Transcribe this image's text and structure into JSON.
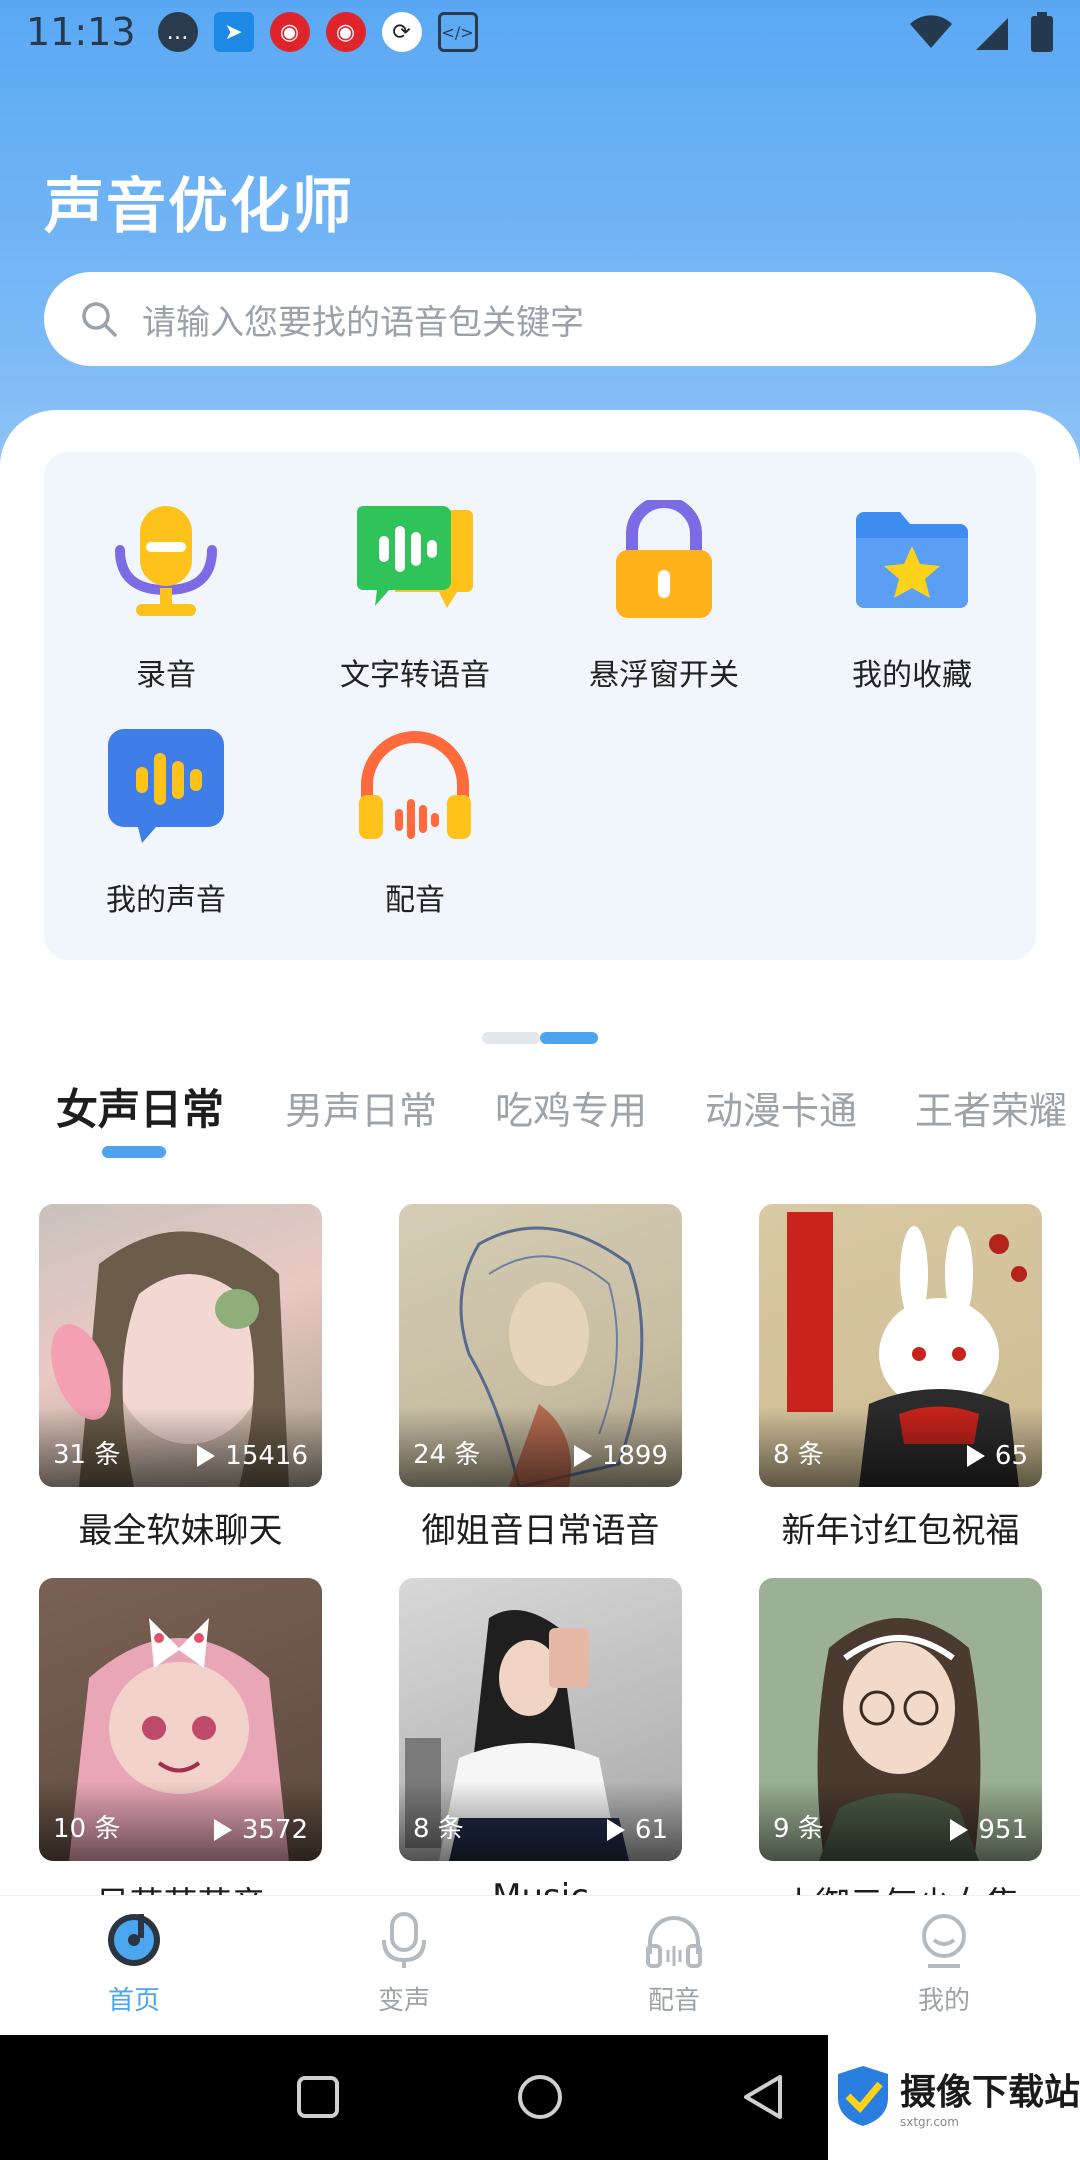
{
  "status_bar": {
    "time": "11:13"
  },
  "app": {
    "title": "声音优化师"
  },
  "search": {
    "placeholder": "请输入您要找的语音包关键字"
  },
  "tools": [
    {
      "label": "录音",
      "icon": "microphone-icon"
    },
    {
      "label": "文字转语音",
      "icon": "text-to-speech-icon"
    },
    {
      "label": "悬浮窗开关",
      "icon": "lock-icon"
    },
    {
      "label": "我的收藏",
      "icon": "star-folder-icon"
    },
    {
      "label": "我的声音",
      "icon": "voice-bubble-icon"
    },
    {
      "label": "配音",
      "icon": "headphones-icon"
    }
  ],
  "categories": [
    "女声日常",
    "男声日常",
    "吃鸡专用",
    "动漫卡通",
    "王者荣耀"
  ],
  "active_category": "女声日常",
  "cards": [
    {
      "title": "最全软妹聊天",
      "count": "31 条",
      "plays": "15416"
    },
    {
      "title": "御姐音日常语音",
      "count": "24 条",
      "plays": "1899"
    },
    {
      "title": "新年讨红包祝福",
      "count": "8 条",
      "plays": "65"
    },
    {
      "title": "呆萌萌萌音",
      "count": "10 条",
      "plays": "3572"
    },
    {
      "title": "Music",
      "count": "8 条",
      "plays": "61"
    },
    {
      "title": "小御元气少女集",
      "count": "9 条",
      "plays": "951"
    }
  ],
  "tabbar": [
    {
      "label": "首页",
      "icon": "home-disc-icon"
    },
    {
      "label": "变声",
      "icon": "microphone-icon"
    },
    {
      "label": "配音",
      "icon": "headphones-icon"
    },
    {
      "label": "我的",
      "icon": "profile-icon"
    }
  ],
  "watermark": {
    "text": "摄像下载站",
    "sub": "sxtgr.com"
  },
  "colors": {
    "accent": "#4aa6ef",
    "header": "#5aa8f4"
  }
}
